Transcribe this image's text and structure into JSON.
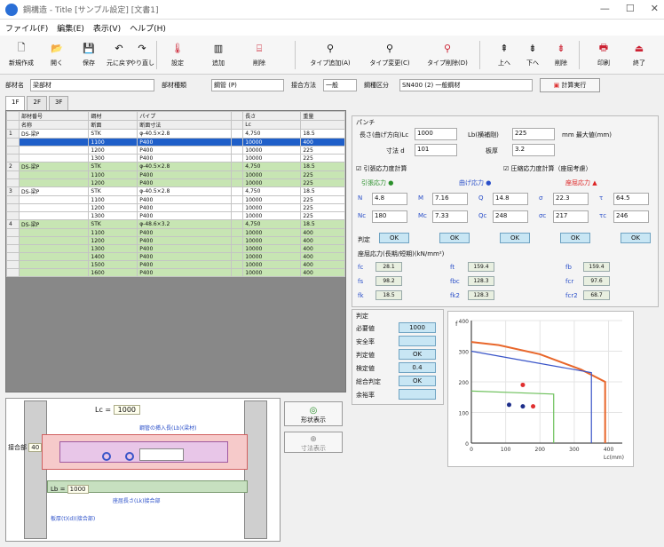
{
  "window": {
    "title": "鋼構造 - Title  [サンプル設定]  [文書1]",
    "min": "—",
    "max": "☐",
    "close": "✕"
  },
  "menu": [
    "ファイル(F)",
    "編集(E)",
    "表示(V)",
    "ヘルプ(H)"
  ],
  "toolbar": [
    {
      "label": "新規作成",
      "icon": "new-icon"
    },
    {
      "label": "開く",
      "icon": "open-icon"
    },
    {
      "label": "保存",
      "icon": "save-icon"
    },
    {
      "label": "元に戻す",
      "icon": "undo-icon"
    },
    {
      "label": "やり直し",
      "icon": "redo-icon"
    },
    {
      "label": "設定",
      "icon": "settings-icon"
    },
    {
      "label": "追加",
      "icon": "add-icon"
    },
    {
      "label": "削除",
      "icon": "delete-icon"
    },
    {
      "label": "タイプ追加(A)",
      "icon": "type-add-icon"
    },
    {
      "label": "タイプ変更(C)",
      "icon": "type-change-icon"
    },
    {
      "label": "タイプ削除(D)",
      "icon": "type-delete-icon"
    },
    {
      "label": "上へ",
      "icon": "up-icon"
    },
    {
      "label": "下へ",
      "icon": "down-icon"
    },
    {
      "label": "削除",
      "icon": "remove-icon"
    },
    {
      "label": "印刷",
      "icon": "print-icon"
    },
    {
      "label": "終了",
      "icon": "exit-icon"
    }
  ],
  "fields": {
    "name_label": "部材名",
    "name_value": "梁部材",
    "type_label": "部材種類",
    "type_value": "鋼管 (P)",
    "method_label": "接合方法",
    "method_value": "一般",
    "grade_label": "鋼種区分",
    "grade_value": "SN400 (2) 一般鋼材",
    "calc_button": "計算実行"
  },
  "tabs": [
    "1F",
    "2F",
    "3F"
  ],
  "grid": {
    "headers1": [
      "",
      "部材番号",
      "鋼材",
      "パイプ",
      "",
      "長さ",
      "重量"
    ],
    "headers2": [
      "",
      "名称",
      "断面",
      "断面寸法",
      "",
      "Lc",
      ""
    ],
    "rows": [
      {
        "n": "1",
        "a": "DS-梁P",
        "b": "STK",
        "c": "φ-40.5×2.8",
        "d": "",
        "e": "4,750",
        "f": "18.5",
        "cls": "white"
      },
      {
        "n": "",
        "a": "",
        "b": "1100",
        "c": "P400",
        "d": "",
        "e": "10000",
        "f": "400",
        "cls": "sel"
      },
      {
        "n": "",
        "a": "",
        "b": "1200",
        "c": "P400",
        "d": "",
        "e": "10000",
        "f": "225",
        "cls": "white"
      },
      {
        "n": "",
        "a": "",
        "b": "1300",
        "c": "P400",
        "d": "",
        "e": "10000",
        "f": "225",
        "cls": "white"
      },
      {
        "n": "2",
        "a": "DS-梁P",
        "b": "STK",
        "c": "φ-40.5×2.8",
        "d": "",
        "e": "4,750",
        "f": "18.5",
        "cls": "green"
      },
      {
        "n": "",
        "a": "",
        "b": "1100",
        "c": "P400",
        "d": "",
        "e": "10000",
        "f": "225",
        "cls": "green"
      },
      {
        "n": "",
        "a": "",
        "b": "1200",
        "c": "P400",
        "d": "",
        "e": "10000",
        "f": "225",
        "cls": "green"
      },
      {
        "n": "3",
        "a": "DS-梁P",
        "b": "STK",
        "c": "φ-40.5×2.8",
        "d": "",
        "e": "4,750",
        "f": "18.5",
        "cls": "white"
      },
      {
        "n": "",
        "a": "",
        "b": "1100",
        "c": "P400",
        "d": "",
        "e": "10000",
        "f": "225",
        "cls": "white"
      },
      {
        "n": "",
        "a": "",
        "b": "1200",
        "c": "P400",
        "d": "",
        "e": "10000",
        "f": "225",
        "cls": "white"
      },
      {
        "n": "",
        "a": "",
        "b": "1300",
        "c": "P400",
        "d": "",
        "e": "10000",
        "f": "225",
        "cls": "white"
      },
      {
        "n": "4",
        "a": "DS-梁P",
        "b": "STK",
        "c": "φ-48.6×3.2",
        "d": "",
        "e": "4,750",
        "f": "18.5",
        "cls": "green"
      },
      {
        "n": "",
        "a": "",
        "b": "1100",
        "c": "P400",
        "d": "",
        "e": "10000",
        "f": "400",
        "cls": "green"
      },
      {
        "n": "",
        "a": "",
        "b": "1200",
        "c": "P400",
        "d": "",
        "e": "10000",
        "f": "400",
        "cls": "green"
      },
      {
        "n": "",
        "a": "",
        "b": "1300",
        "c": "P400",
        "d": "",
        "e": "10000",
        "f": "400",
        "cls": "green"
      },
      {
        "n": "",
        "a": "",
        "b": "1400",
        "c": "P400",
        "d": "",
        "e": "10000",
        "f": "400",
        "cls": "green"
      },
      {
        "n": "",
        "a": "",
        "b": "1500",
        "c": "P400",
        "d": "",
        "e": "10000",
        "f": "400",
        "cls": "green"
      },
      {
        "n": "",
        "a": "",
        "b": "1600",
        "c": "P400",
        "d": "",
        "e": "10000",
        "f": "400",
        "cls": "green"
      }
    ]
  },
  "right": {
    "group_title": "パンチ",
    "r1_label": "長さ(曲げ方向)Lc",
    "r1_value": "1000",
    "r1_label2": "Lb(横補剛)",
    "r1_value2": "225",
    "r1_unit": "mm 最大値(mm)",
    "r2_label": "寸法 d",
    "r2_value": "101",
    "r2_label2": "板厚",
    "r2_value2": "3.2",
    "check1": "引張応力度計算",
    "check2": "圧縮応力度計算（座屈考慮）",
    "legend": [
      "引張応力 ●",
      "曲げ応力 ●",
      "座屈応力 ▲"
    ],
    "params": [
      {
        "a": "N",
        "v1": "4.8",
        "b": "M",
        "v2": "7.16",
        "c": "Q",
        "v3": "14.8",
        "d": "σ",
        "v4": "22.3",
        "e": "τ",
        "v5": "64.5"
      },
      {
        "a": "Nc",
        "v1": "180",
        "b": "Mc",
        "v2": "7.33",
        "c": "Qc",
        "v3": "248",
        "d": "σc",
        "v4": "217",
        "e": "τc",
        "v5": "246"
      }
    ],
    "ok_label": "判定",
    "ok": [
      "OK",
      "OK",
      "OK",
      "OK",
      "OK"
    ],
    "sub_title": "座屈応力(長期/短期)(kN/mm²)",
    "sub_rows": [
      {
        "a": "fc",
        "v": "28.1",
        "b": "ft",
        "w": "159.4",
        "c": "fb",
        "x": "159.4"
      },
      {
        "a": "fs",
        "v": "98.2",
        "b": "fbc",
        "w": "128.3",
        "c": "fcr",
        "x": "97.6"
      },
      {
        "a": "fk",
        "v": "18.5",
        "b": "fk2",
        "w": "128.3",
        "c": "fcr2",
        "x": "68.7"
      }
    ],
    "judge_title": "判定",
    "judge_rows": [
      {
        "label": "必要値",
        "value": "1000"
      },
      {
        "label": "安全率",
        "value": ""
      },
      {
        "label": "判定値",
        "value": "OK"
      },
      {
        "label": "検定値",
        "value": "0.4"
      },
      {
        "label": "総合判定",
        "value": "OK"
      },
      {
        "label": "余裕率",
        "value": ""
      }
    ]
  },
  "diagram": {
    "lc_label": "Lc =",
    "lc_value": "1000",
    "left_label": "接合部",
    "left_value": "40",
    "bottom_label": "Lb =",
    "bottom_value": "1000",
    "note1": "鋼管の挿入長(Lb)(梁材)",
    "note2": "座屈長さ(Lk)接合部",
    "note3": "板厚(t)(d)(接合部)",
    "btn1": "形状表示",
    "btn2": "寸法表示"
  },
  "chart_data": {
    "type": "line",
    "xlabel": "Lc(mm)",
    "ylabel": "f",
    "xticks": [
      "0",
      "100",
      "200",
      "300",
      "400"
    ],
    "yticks": [
      "0",
      "100",
      "200",
      "300",
      "400"
    ],
    "series": [
      {
        "name": "",
        "color": "#e8662a",
        "points": [
          [
            0,
            330
          ],
          [
            80,
            320
          ],
          [
            200,
            290
          ],
          [
            320,
            240
          ],
          [
            390,
            200
          ],
          [
            390,
            0
          ]
        ]
      },
      {
        "name": "",
        "color": "#3a55c8",
        "points": [
          [
            0,
            300
          ],
          [
            150,
            270
          ],
          [
            300,
            240
          ],
          [
            350,
            230
          ],
          [
            350,
            0
          ]
        ]
      },
      {
        "name": "",
        "color": "#6cc05a",
        "points": [
          [
            0,
            170
          ],
          [
            120,
            165
          ],
          [
            240,
            160
          ],
          [
            240,
            0
          ]
        ]
      }
    ],
    "points": [
      {
        "x": 150,
        "y": 190,
        "color": "#e03030"
      },
      {
        "x": 110,
        "y": 125,
        "color": "#1d2e8a"
      },
      {
        "x": 150,
        "y": 120,
        "color": "#1d2e8a"
      },
      {
        "x": 180,
        "y": 120,
        "color": "#e03030"
      }
    ],
    "xlim": [
      0,
      440
    ],
    "ylim": [
      0,
      400
    ]
  }
}
